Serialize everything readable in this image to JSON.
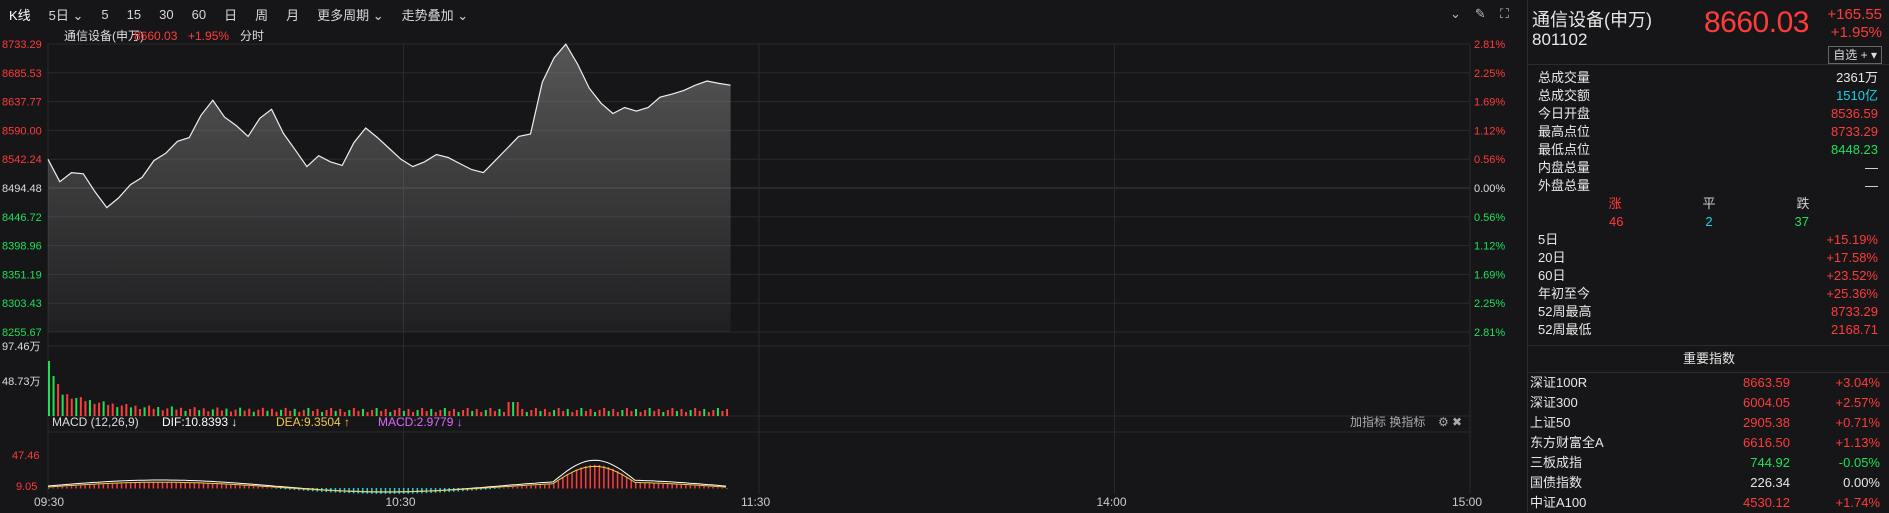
{
  "toolbar": {
    "items": [
      "K线",
      "5日",
      "5",
      "15",
      "30",
      "60",
      "日",
      "周",
      "月",
      "更多周期",
      "走势叠加"
    ]
  },
  "chart": {
    "legend_name": "通信设备(申万)",
    "legend_price": "8660.03",
    "legend_change": "+1.95%",
    "legend_mode": "分时",
    "y_left_labels": [
      "8733.29",
      "8685.53",
      "8637.77",
      "8590.00",
      "8542.24",
      "8494.48",
      "8446.72",
      "8398.96",
      "8351.19",
      "8303.43",
      "8255.67"
    ],
    "y_right_labels": [
      "2.81%",
      "2.25%",
      "1.69%",
      "1.12%",
      "0.56%",
      "0.00%",
      "0.56%",
      "1.12%",
      "1.69%",
      "2.25%",
      "2.81%"
    ],
    "x_labels": [
      "09:30",
      "10:30",
      "11:30",
      "14:00",
      "15:00"
    ],
    "volume_labels": [
      "97.46万",
      "48.73万"
    ],
    "macd_title": "MACD (12,26,9)",
    "macd_dif": "DIF:10.8393",
    "macd_dea": "DEA:9.3504",
    "macd_val": "MACD:2.9779",
    "macd_tools": "加指标 换指标",
    "macd_y_labels": [
      "47.46",
      "9.05"
    ],
    "colors": {
      "up": "#ff3b3b",
      "down": "#1ee05a",
      "dif": "#ffffff",
      "dea": "#f2c94c",
      "macd": "#e066ff",
      "grid": "#2a2a2e"
    }
  },
  "chart_data": {
    "type": "line",
    "title": "通信设备(申万) 分时",
    "ylim": [
      8255.67,
      8733.29
    ],
    "base": 8494.48,
    "x": [
      "09:30",
      "10:30",
      "11:30",
      "14:00",
      "15:00"
    ],
    "series": [
      {
        "name": "通信设备(申万)",
        "values": [
          8542,
          8505,
          8520,
          8518,
          8488,
          8462,
          8478,
          8500,
          8512,
          8540,
          8552,
          8572,
          8578,
          8615,
          8640,
          8612,
          8598,
          8580,
          8610,
          8625,
          8585,
          8558,
          8530,
          8548,
          8538,
          8532,
          8570,
          8594,
          8578,
          8560,
          8542,
          8530,
          8538,
          8550,
          8545,
          8535,
          8525,
          8520,
          8540,
          8560,
          8580,
          8584,
          8670,
          8710,
          8733,
          8700,
          8660,
          8635,
          8618,
          8628,
          8622,
          8628,
          8645,
          8650,
          8656,
          8665,
          8672,
          8668,
          8665
        ]
      }
    ]
  },
  "right": {
    "name": "通信设备(申万)",
    "code": "801102",
    "price": "8660.03",
    "change": "+165.55",
    "change_pct": "+1.95%",
    "btn": "自选 +",
    "stats": [
      {
        "k": "总成交量",
        "v": "2361万",
        "c": "white"
      },
      {
        "k": "总成交额",
        "v": "1510亿",
        "c": "cyan"
      },
      {
        "k": "今日开盘",
        "v": "8536.59",
        "c": "red"
      },
      {
        "k": "最高点位",
        "v": "8733.29",
        "c": "red"
      },
      {
        "k": "最低点位",
        "v": "8448.23",
        "c": "green"
      },
      {
        "k": "内盘总量",
        "v": "—",
        "c": "white"
      },
      {
        "k": "外盘总量",
        "v": "—",
        "c": "white"
      }
    ],
    "updown": {
      "up_label": "涨",
      "flat_label": "平",
      "down_label": "跌",
      "up": "46",
      "flat": "2",
      "down": "37"
    },
    "periods": [
      {
        "k": "5日",
        "v": "+15.19%"
      },
      {
        "k": "20日",
        "v": "+17.58%"
      },
      {
        "k": "60日",
        "v": "+23.52%"
      },
      {
        "k": "年初至今",
        "v": "+25.36%"
      },
      {
        "k": "52周最高",
        "v": "8733.29"
      },
      {
        "k": "52周最低",
        "v": "2168.71"
      }
    ],
    "index_title": "重要指数",
    "indices": [
      {
        "name": "深证100R",
        "price": "8663.59",
        "chg": "+3.04%",
        "c": "red"
      },
      {
        "name": "深证300",
        "price": "6004.05",
        "chg": "+2.57%",
        "c": "red"
      },
      {
        "name": "上证50",
        "price": "2905.38",
        "chg": "+0.71%",
        "c": "red"
      },
      {
        "name": "东方财富全A",
        "price": "6616.50",
        "chg": "+1.13%",
        "c": "red"
      },
      {
        "name": "三板成指",
        "price": "744.92",
        "chg": "-0.05%",
        "c": "green"
      },
      {
        "name": "国债指数",
        "price": "226.34",
        "chg": "0.00%",
        "c": "white"
      },
      {
        "name": "中证A100",
        "price": "4530.12",
        "chg": "+1.74%",
        "c": "red"
      }
    ]
  }
}
